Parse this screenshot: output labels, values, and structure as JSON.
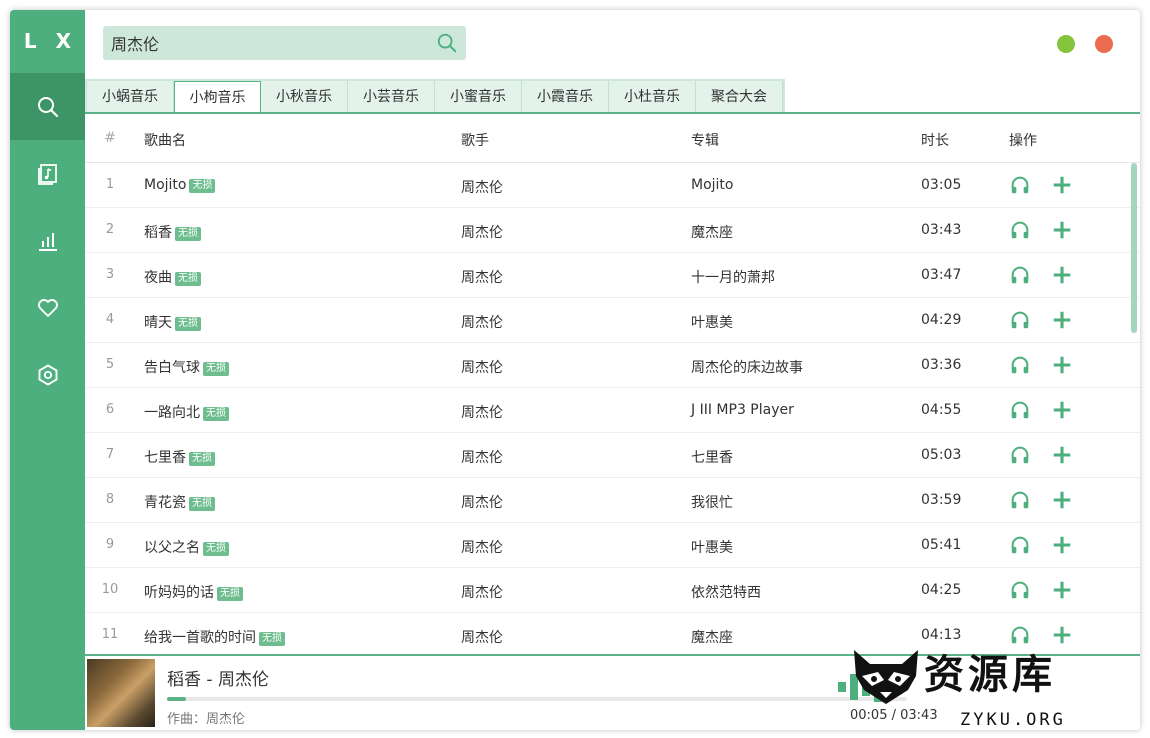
{
  "app": {
    "logo": "L X"
  },
  "sidebar": {
    "items": [
      {
        "icon": "search-icon",
        "active": true
      },
      {
        "icon": "music-library-icon",
        "active": false
      },
      {
        "icon": "chart-bars-icon",
        "active": false
      },
      {
        "icon": "heart-icon",
        "active": false
      },
      {
        "icon": "settings-icon",
        "active": false
      }
    ]
  },
  "search": {
    "value": "周杰伦",
    "icon": "search-icon"
  },
  "window_controls": {
    "minimize_color": "#85c43c",
    "close_color": "#ea6b4e"
  },
  "tabs": [
    {
      "label": "小蜗音乐",
      "active": false
    },
    {
      "label": "小枸音乐",
      "active": true
    },
    {
      "label": "小秋音乐",
      "active": false
    },
    {
      "label": "小芸音乐",
      "active": false
    },
    {
      "label": "小蜜音乐",
      "active": false
    },
    {
      "label": "小霞音乐",
      "active": false
    },
    {
      "label": "小杜音乐",
      "active": false
    },
    {
      "label": "聚合大会",
      "active": false
    }
  ],
  "table": {
    "headers": {
      "num": "#",
      "name": "歌曲名",
      "artist": "歌手",
      "album": "专辑",
      "duration": "时长",
      "ops": "操作"
    },
    "badge_label": "无损",
    "rows": [
      {
        "num": "1",
        "name": "Mojito",
        "artist": "周杰伦",
        "album": "Mojito",
        "duration": "03:05"
      },
      {
        "num": "2",
        "name": "稻香",
        "artist": "周杰伦",
        "album": "魔杰座",
        "duration": "03:43"
      },
      {
        "num": "3",
        "name": "夜曲",
        "artist": "周杰伦",
        "album": "十一月的萧邦",
        "duration": "03:47"
      },
      {
        "num": "4",
        "name": "晴天",
        "artist": "周杰伦",
        "album": "叶惠美",
        "duration": "04:29"
      },
      {
        "num": "5",
        "name": "告白气球",
        "artist": "周杰伦",
        "album": "周杰伦的床边故事",
        "duration": "03:36"
      },
      {
        "num": "6",
        "name": "一路向北",
        "artist": "周杰伦",
        "album": "J III MP3 Player",
        "duration": "04:55"
      },
      {
        "num": "7",
        "name": "七里香",
        "artist": "周杰伦",
        "album": "七里香",
        "duration": "05:03"
      },
      {
        "num": "8",
        "name": "青花瓷",
        "artist": "周杰伦",
        "album": "我很忙",
        "duration": "03:59"
      },
      {
        "num": "9",
        "name": "以父之名",
        "artist": "周杰伦",
        "album": "叶惠美",
        "duration": "05:41"
      },
      {
        "num": "10",
        "name": "听妈妈的话",
        "artist": "周杰伦",
        "album": "依然范特西",
        "duration": "04:25"
      },
      {
        "num": "11",
        "name": "给我一首歌的时间",
        "artist": "周杰伦",
        "album": "魔杰座",
        "duration": "04:13"
      }
    ]
  },
  "player": {
    "title": "稻香 - 周杰伦",
    "composer": "作曲：周杰伦",
    "elapsed": "00:05",
    "separator": " / ",
    "total": "03:43",
    "progress": 0.025
  },
  "watermark": {
    "text": "资源库",
    "sub": "ZYKU.ORG"
  },
  "colors": {
    "accent": "#4caf7d",
    "accent_dark": "#3d9467",
    "search_bg": "#cde8da"
  }
}
